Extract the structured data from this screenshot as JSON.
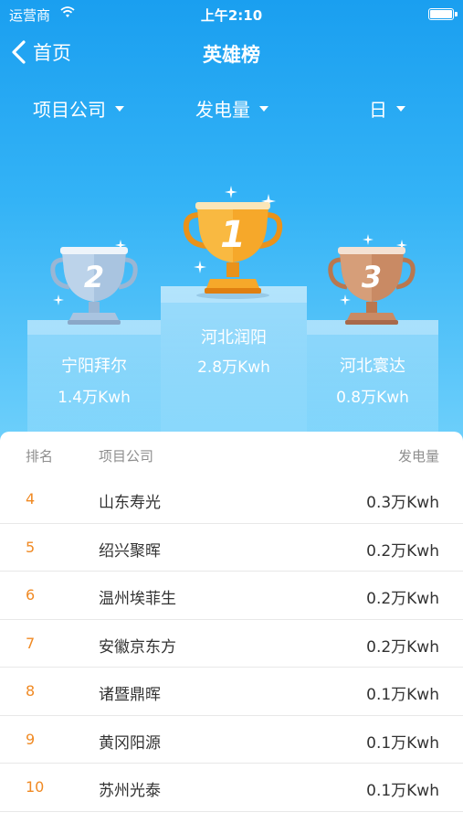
{
  "status_bar": {
    "carrier": "运营商",
    "time": "上午2:10"
  },
  "nav": {
    "back_label": "首页",
    "title": "英雄榜"
  },
  "filters": [
    {
      "label": "项目公司"
    },
    {
      "label": "发电量"
    },
    {
      "label": "日"
    }
  ],
  "podium": {
    "first": {
      "rank": "1",
      "name": "河北润阳",
      "value": "2.8万Kwh"
    },
    "second": {
      "rank": "2",
      "name": "宁阳拜尔",
      "value": "1.4万Kwh"
    },
    "third": {
      "rank": "3",
      "name": "河北寰达",
      "value": "0.8万Kwh"
    }
  },
  "list": {
    "headers": {
      "rank": "排名",
      "company": "项目公司",
      "value": "发电量"
    },
    "rows": [
      {
        "rank": "4",
        "company": "山东寿光",
        "value": "0.3万Kwh"
      },
      {
        "rank": "5",
        "company": "绍兴聚晖",
        "value": "0.2万Kwh"
      },
      {
        "rank": "6",
        "company": "温州埃菲生",
        "value": "0.2万Kwh"
      },
      {
        "rank": "7",
        "company": "安徽京东方",
        "value": "0.2万Kwh"
      },
      {
        "rank": "8",
        "company": "诸暨鼎晖",
        "value": "0.1万Kwh"
      },
      {
        "rank": "9",
        "company": "黄冈阳源",
        "value": "0.1万Kwh"
      },
      {
        "rank": "10",
        "company": "苏州光泰",
        "value": "0.1万Kwh"
      }
    ]
  },
  "colors": {
    "hero_top": "#1a9ff0",
    "hero_bottom": "#6fd0fb",
    "rank_accent": "#f08a24",
    "gold": "#f4a623",
    "silver": "#a9c4e0",
    "bronze": "#c98a64"
  }
}
